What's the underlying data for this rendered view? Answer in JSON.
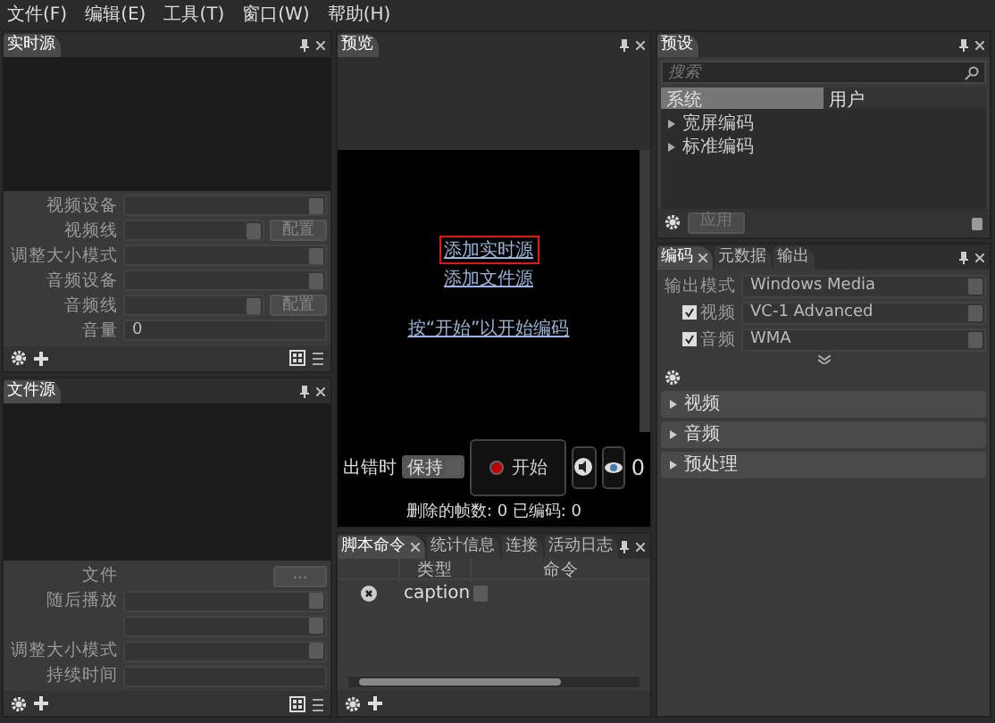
{
  "menu": [
    "文件(F)",
    "编辑(E)",
    "工具(T)",
    "窗口(W)",
    "帮助(H)"
  ],
  "live_source": {
    "title": "实时源",
    "fields": [
      {
        "kind": "select",
        "label": "视频设备"
      },
      {
        "kind": "select_button",
        "label": "视频线",
        "button": "配置"
      },
      {
        "kind": "select",
        "label": "调整大小模式"
      },
      {
        "kind": "select",
        "label": "音频设备"
      },
      {
        "kind": "select_button",
        "label": "音频线",
        "button": "配置"
      },
      {
        "kind": "text",
        "label": "音量",
        "value": "0"
      }
    ]
  },
  "file_source": {
    "title": "文件源",
    "fields": [
      {
        "kind": "button",
        "label": "文件",
        "button": "..."
      },
      {
        "kind": "select",
        "label": "随后播放"
      },
      {
        "kind": "select"
      },
      {
        "kind": "select",
        "label": "调整大小模式"
      },
      {
        "kind": "text",
        "label": "持续时间"
      }
    ]
  },
  "preview": {
    "title": "预览",
    "links": [
      {
        "text": "添加实时源",
        "highlighted": true
      },
      {
        "text": "添加文件源",
        "highlighted": false
      },
      {
        "text": "按“开始”以开始编码",
        "highlighted": false
      }
    ],
    "on_error_label": "出错时",
    "on_error_value": "保持",
    "start_button": "开始",
    "timecode": "0",
    "status": "删除的帧数: 0 已编码: 0"
  },
  "script_panel": {
    "tabs": [
      {
        "label": "脚本命令",
        "selected": true,
        "closable": true
      },
      {
        "label": "统计信息",
        "selected": false,
        "closable": false
      },
      {
        "label": "连接",
        "selected": false,
        "closable": false
      },
      {
        "label": "活动日志",
        "selected": false,
        "closable": false
      }
    ],
    "columns": [
      "类型",
      "命令"
    ],
    "rows": [
      {
        "type": "caption"
      }
    ]
  },
  "presets": {
    "title": "预设",
    "search": {
      "placeholder": "搜索"
    },
    "tabs": [
      {
        "label": "系统",
        "selected": true
      },
      {
        "label": "用户",
        "selected": false
      }
    ],
    "items": [
      {
        "label": "宽屏编码",
        "expanded": false
      },
      {
        "label": "标准编码",
        "expanded": false
      }
    ],
    "apply_button": {
      "label": "应用",
      "disabled": true
    }
  },
  "encode": {
    "tabs": [
      {
        "label": "编码",
        "selected": true,
        "closable": true
      },
      {
        "label": "元数据",
        "selected": false,
        "closable": false
      },
      {
        "label": "输出",
        "selected": false,
        "closable": false
      }
    ],
    "output_mode": {
      "label": "输出模式",
      "value": "Windows Media"
    },
    "streams": [
      {
        "label": "视频",
        "checked": true,
        "value": "VC-1 Advanced"
      },
      {
        "label": "音频",
        "checked": true,
        "value": "WMA"
      }
    ],
    "sections": [
      {
        "label": "视频",
        "expanded": false
      },
      {
        "label": "音频",
        "expanded": false
      },
      {
        "label": "预处理",
        "expanded": false
      }
    ]
  }
}
